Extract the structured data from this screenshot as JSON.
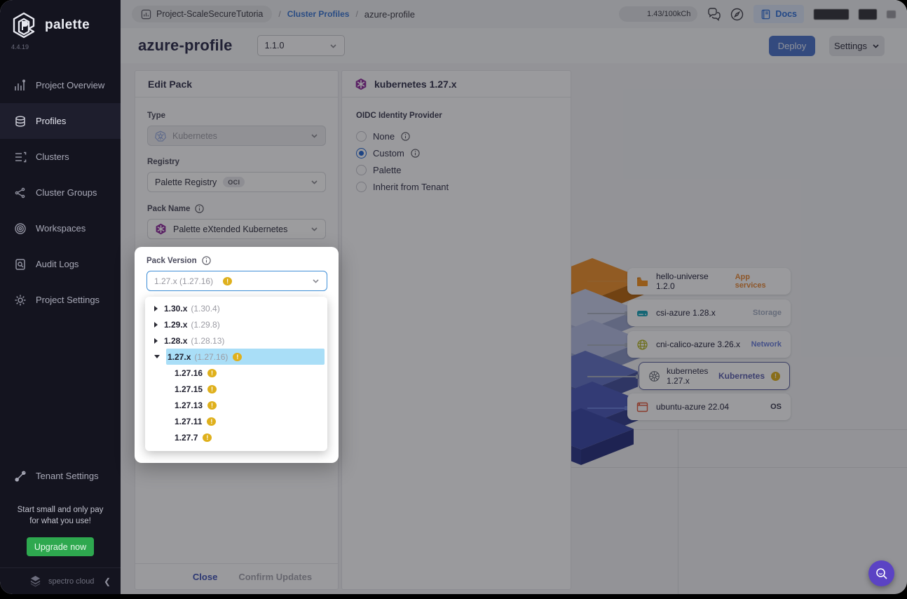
{
  "app": {
    "name": "palette",
    "version": "4.4.19"
  },
  "sidebar": {
    "items": [
      {
        "label": "Project Overview"
      },
      {
        "label": "Profiles"
      },
      {
        "label": "Clusters"
      },
      {
        "label": "Cluster Groups"
      },
      {
        "label": "Workspaces"
      },
      {
        "label": "Audit Logs"
      },
      {
        "label": "Project Settings"
      }
    ],
    "tenant_settings": "Tenant Settings",
    "promo_line1": "Start small and only pay",
    "promo_line2": "for what you use!",
    "upgrade_button": "Upgrade now",
    "brand_footer": "spectro cloud"
  },
  "topbar": {
    "breadcrumb_project": "Project-ScaleSecureTutoria",
    "breadcrumb_section": "Cluster Profiles",
    "breadcrumb_current": "azure-profile",
    "credits": "1.43/100kCh",
    "docs_label": "Docs"
  },
  "header": {
    "title": "azure-profile",
    "version_select": "1.1.0",
    "deploy_button": "Deploy",
    "settings_button": "Settings"
  },
  "edit_pack": {
    "title": "Edit Pack",
    "type_label": "Type",
    "type_value": "Kubernetes",
    "registry_label": "Registry",
    "registry_value": "Palette Registry",
    "registry_badge": "OCI",
    "pack_name_label": "Pack Name",
    "pack_name_value": "Palette eXtended Kubernetes",
    "close_button": "Close",
    "confirm_button": "Confirm Updates"
  },
  "pack_version": {
    "label": "Pack Version",
    "value": "1.27.x (1.27.16)",
    "groups": [
      {
        "version": "1.30.x",
        "latest": "(1.30.4)"
      },
      {
        "version": "1.29.x",
        "latest": "(1.29.8)"
      },
      {
        "version": "1.28.x",
        "latest": "(1.28.13)"
      },
      {
        "version": "1.27.x",
        "latest": "(1.27.16)"
      }
    ],
    "children": [
      "1.27.16",
      "1.27.15",
      "1.27.13",
      "1.27.11",
      "1.27.7"
    ]
  },
  "pack_panel": {
    "title": "kubernetes 1.27.x",
    "oidc_label": "OIDC Identity Provider",
    "options": [
      {
        "label": "None"
      },
      {
        "label": "Custom"
      },
      {
        "label": "Palette"
      },
      {
        "label": "Inherit from Tenant"
      }
    ],
    "selected_option": "Custom"
  },
  "diagram": {
    "layers": [
      {
        "name": "hello-universe 1.2.0",
        "category": "App services"
      },
      {
        "name": "csi-azure 1.28.x",
        "category": "Storage"
      },
      {
        "name": "cni-calico-azure 3.26.x",
        "category": "Network"
      },
      {
        "name": "kubernetes 1.27.x",
        "category": "Kubernetes"
      },
      {
        "name": "ubuntu-azure 22.04",
        "category": "OS"
      }
    ]
  },
  "colors": {
    "accent_blue": "#2f6fd8",
    "warning_gold": "#dfb01c",
    "highlight_blue": "#a9def7",
    "upgrade_green": "#2ea84f",
    "deploy_blue": "#4a72c8",
    "fab_purple": "#5b43c4",
    "selected_border": "#5a5f9e",
    "app_services_orange": "#d0802f"
  }
}
